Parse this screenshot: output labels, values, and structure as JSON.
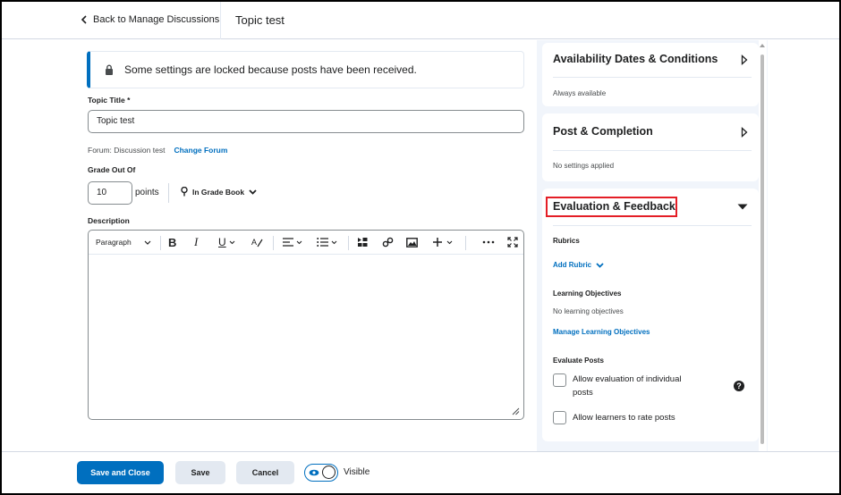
{
  "header": {
    "back_label": "Back to Manage Discussions",
    "page_title": "Topic test"
  },
  "alert": {
    "text": "Some settings are locked because posts have been received."
  },
  "form": {
    "topic_title_label": "Topic Title *",
    "topic_title_value": "Topic test",
    "forum_prefix": "Forum: Discussion test",
    "change_forum_label": "Change Forum",
    "grade_label": "Grade Out Of",
    "grade_value": "10",
    "points_label": "points",
    "gradebook_label": "In Grade Book",
    "description_label": "Description"
  },
  "editor": {
    "paragraph_label": "Paragraph",
    "tools": [
      "bold-icon",
      "italic-icon",
      "underline-icon",
      "clear-format-icon",
      "align-icon",
      "list-icon",
      "insert-media-icon",
      "link-icon",
      "image-icon",
      "add-icon",
      "more-icon",
      "fullscreen-icon"
    ]
  },
  "sidebar": {
    "availability": {
      "title": "Availability Dates & Conditions",
      "subtitle": "Always available"
    },
    "post_completion": {
      "title": "Post & Completion",
      "subtitle": "No settings applied"
    },
    "evaluation": {
      "title": "Evaluation & Feedback",
      "rubrics_label": "Rubrics",
      "add_rubric_label": "Add Rubric",
      "objectives_label": "Learning Objectives",
      "objectives_text": "No learning objectives",
      "manage_objectives_label": "Manage Learning Objectives",
      "evaluate_posts_label": "Evaluate Posts",
      "allow_individual_label": "Allow evaluation of individual posts",
      "allow_individual_checked": false,
      "allow_rate_label": "Allow learners to rate posts",
      "allow_rate_checked": false,
      "help_glyph": "?"
    }
  },
  "footer": {
    "save_close_label": "Save and Close",
    "save_label": "Save",
    "cancel_label": "Cancel",
    "visible_label": "Visible",
    "visible_on": true
  },
  "colors": {
    "accent": "#006fbf",
    "highlight": "#e41e26",
    "panel_bg": "#f1f5fb"
  }
}
